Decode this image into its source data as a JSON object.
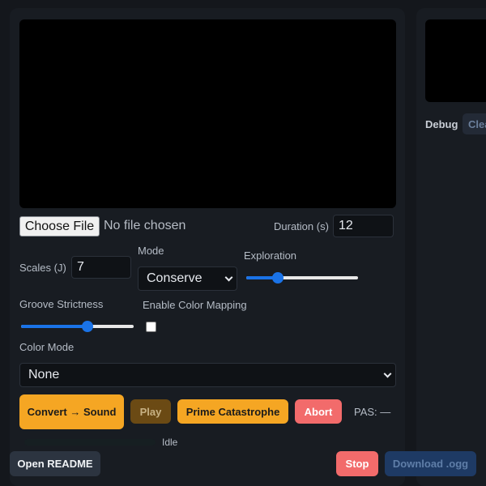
{
  "file": {
    "button_label": "Choose File",
    "status": "No file chosen"
  },
  "duration": {
    "label": "Duration (s)",
    "value": "12"
  },
  "scales": {
    "label": "Scales (J)",
    "value": "7"
  },
  "mode": {
    "label": "Mode",
    "selected": "Conserve"
  },
  "exploration": {
    "label": "Exploration",
    "value": 0.28
  },
  "groove": {
    "label": "Groove Strictness",
    "value": 0.59
  },
  "color_mapping": {
    "label": "Enable Color Mapping",
    "checked": false
  },
  "color_mode": {
    "label": "Color Mode",
    "selected": "None"
  },
  "buttons": {
    "convert": "Convert → Sound",
    "play": "Play",
    "prime": "Prime Catastrophe",
    "abort": "Abort",
    "readme": "Open README",
    "stop": "Stop",
    "download": "Download .ogg"
  },
  "pas": {
    "text": "PAS: —"
  },
  "progress": {
    "value": 0,
    "status": "Idle"
  },
  "debug": {
    "label": "Debug",
    "clear_label": "Clear"
  },
  "colors": {
    "accent_orange": "#f5a623",
    "danger_red": "#f26b6b",
    "slider_blue": "#1a73e8",
    "background": "#14171c"
  }
}
